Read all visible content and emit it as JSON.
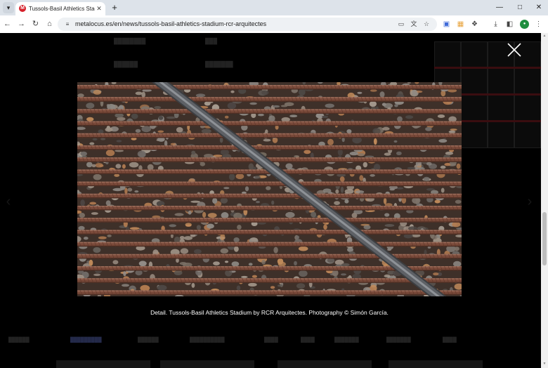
{
  "browser": {
    "tab": {
      "title": "Tussols-Basil Athletics Stadium",
      "favicon": "M"
    },
    "url": "metalocus.es/en/news/tussols-basil-athletics-stadium-rcr-arquitectes",
    "icons": {
      "tab_menu": "chevron-down-icon",
      "close_tab": "close-icon",
      "new_tab": "plus-icon",
      "minimize": "minimize-icon",
      "maximize": "maximize-icon",
      "close_window": "close-window-icon",
      "back": "arrow-left-icon",
      "forward": "arrow-right-icon",
      "reload": "reload-icon",
      "home": "home-icon",
      "site_info": "site-settings-icon",
      "install": "install-app-icon",
      "translate": "translate-icon",
      "bookmark": "star-icon",
      "download": "download-icon",
      "side_panel": "side-panel-icon",
      "menu": "kebab-menu-icon"
    },
    "profile_color": "#1e8e3e"
  },
  "lightbox": {
    "caption": "Detail. Tussols-Basil Athletics Stadium by RCR Arquitectes. Photography © Simón García.",
    "image": {
      "subject": "rebar-over-gravel-photo",
      "steel_bar_color": "#5e6166",
      "rebar_color": "#7a4a3a"
    },
    "close_icon": "close-x-icon"
  },
  "colors": {
    "overlay": "#000000",
    "tab_strip": "#dde3ea",
    "toolbar": "#ffffff",
    "omnibox": "#eef1f4",
    "brand": "#d6202a"
  }
}
